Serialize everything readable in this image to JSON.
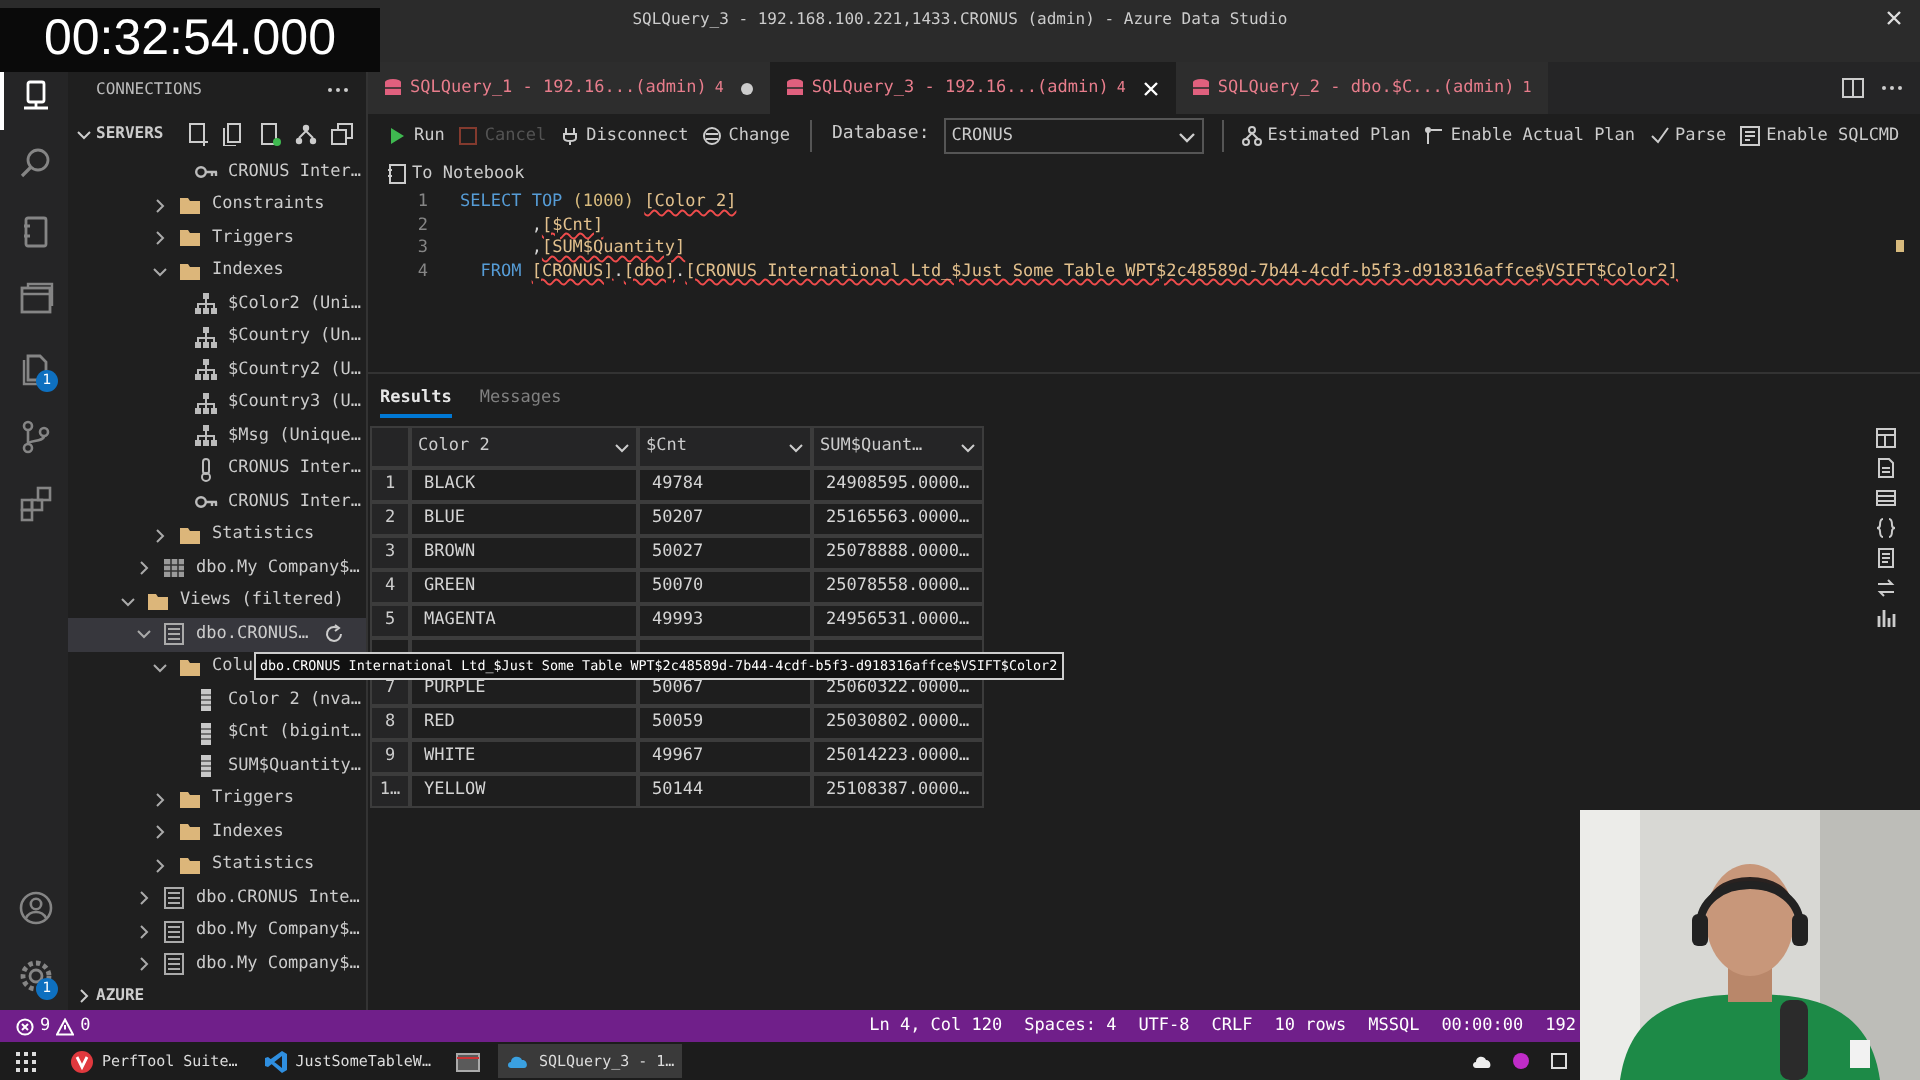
{
  "window": {
    "title": "SQLQuery_3 - 192.168.100.221,1433.CRONUS (admin) - Azure Data Studio"
  },
  "timer": "00:32:54.000",
  "activity_bar": {
    "items": [
      {
        "selected": true
      },
      {
        "selected": false
      },
      {
        "selected": false
      },
      {
        "selected": false
      },
      {
        "selected": false,
        "badge": "1"
      },
      {
        "selected": false
      },
      {
        "selected": false
      }
    ],
    "bottom_items": [
      {
        "selected": false
      },
      {
        "selected": false,
        "badge": "1"
      }
    ]
  },
  "sidebar": {
    "title": "CONNECTIONS",
    "section": "SERVERS",
    "footer_section": "AZURE",
    "tree": [
      {
        "kind": "offscreen",
        "children": [
          {
            "kind": "offscreen",
            "children": [
              {
                "kind": "offscreen",
                "children": [
                  {
                    "kind": "key",
                    "label": "CRONUS Inter…",
                    "selected": false
                  }
                ]
              },
              {
                "kind": "folder",
                "label": "Constraints",
                "expanded": false,
                "selected": false
              },
              {
                "kind": "folder",
                "label": "Triggers",
                "expanded": false,
                "selected": false
              },
              {
                "kind": "folder",
                "label": "Indexes",
                "expanded": true,
                "selected": false,
                "children": [
                  {
                    "kind": "index",
                    "label": "$Color2 (Uni…",
                    "selected": false
                  },
                  {
                    "kind": "index",
                    "label": "$Country (Un…",
                    "selected": false
                  },
                  {
                    "kind": "index",
                    "label": "$Country2 (U…",
                    "selected": false
                  },
                  {
                    "kind": "index",
                    "label": "$Country3 (U…",
                    "selected": false
                  },
                  {
                    "kind": "index",
                    "label": "$Msg (Unique…",
                    "selected": false
                  },
                  {
                    "kind": "check",
                    "label": "CRONUS Inter…",
                    "selected": false
                  },
                  {
                    "kind": "key",
                    "label": "CRONUS Inter…",
                    "selected": false
                  }
                ]
              },
              {
                "kind": "folder",
                "label": "Statistics",
                "expanded": false,
                "selected": false
              }
            ]
          },
          {
            "kind": "table",
            "label": "dbo.My Company$…",
            "expanded": false,
            "selected": false
          }
        ]
      },
      {
        "kind": "folder",
        "label": "Views (filtered)",
        "expanded": true,
        "selected": false,
        "children": [
          {
            "kind": "view",
            "label": "dbo.CRONUS…",
            "expanded": true,
            "selected": true,
            "children": [
              {
                "kind": "folder",
                "label": "Colu",
                "expanded": true,
                "selected": false,
                "children": [
                  {
                    "kind": "column",
                    "label": "Color 2 (nva…",
                    "selected": false
                  },
                  {
                    "kind": "column",
                    "label": "$Cnt (bigint…",
                    "selected": false
                  },
                  {
                    "kind": "column",
                    "label": "SUM$Quantity…",
                    "selected": false
                  }
                ]
              },
              {
                "kind": "folder",
                "label": "Triggers",
                "expanded": false,
                "selected": false
              },
              {
                "kind": "folder",
                "label": "Indexes",
                "expanded": false,
                "selected": false
              },
              {
                "kind": "folder",
                "label": "Statistics",
                "expanded": false,
                "selected": false
              }
            ]
          },
          {
            "kind": "view",
            "label": "dbo.CRONUS Inte…",
            "expanded": false,
            "selected": false
          },
          {
            "kind": "view",
            "label": "dbo.My Company$…",
            "expanded": false,
            "selected": false
          },
          {
            "kind": "view",
            "label": "dbo.My Company$…",
            "expanded": false,
            "selected": false
          }
        ]
      }
    ]
  },
  "editor": {
    "tabs": [
      {
        "label": "SQLQuery_1 - 192.16...(admin)",
        "count": "4",
        "selected": false,
        "dirty": true
      },
      {
        "label": "SQLQuery_3 - 192.16...(admin)",
        "count": "4",
        "selected": true,
        "dirty": false
      },
      {
        "label": "SQLQuery_2 - dbo.$C...(admin)",
        "count": "1",
        "selected": false,
        "dirty": false
      }
    ],
    "toolbar": {
      "buttons": [
        {
          "label": "Run",
          "disabled": false
        },
        {
          "label": "Cancel",
          "disabled": true
        },
        {
          "label": "Disconnect",
          "disabled": false
        },
        {
          "label": "Change",
          "disabled": false
        }
      ],
      "database_label": "Database:",
      "database": "CRONUS",
      "actions": [
        "Estimated Plan",
        "Enable Actual Plan",
        "Parse",
        "Enable SQLCMD"
      ],
      "notebook": "To Notebook"
    },
    "code": [
      {
        "number": "1",
        "tokens": [
          {
            "kind": "keyword",
            "text": "SELECT TOP "
          },
          {
            "kind": "number",
            "text": "(1000) "
          },
          {
            "kind": "identifier",
            "text": "[Color 2]",
            "error": true
          }
        ]
      },
      {
        "number": "2",
        "tokens": [
          {
            "kind": "punct",
            "text": "       ,"
          },
          {
            "kind": "identifier",
            "text": "[$Cnt]",
            "error": true
          }
        ]
      },
      {
        "number": "3",
        "tokens": [
          {
            "kind": "punct",
            "text": "       ,"
          },
          {
            "kind": "identifier",
            "text": "[SUM$Quantity]",
            "error": true
          }
        ]
      },
      {
        "number": "4",
        "tokens": [
          {
            "kind": "keyword",
            "text": "  FROM "
          },
          {
            "kind": "identifier",
            "text": "[CRONUS]",
            "error": true
          },
          {
            "kind": "punct",
            "text": "."
          },
          {
            "kind": "identifier",
            "text": "[dbo]",
            "error": true
          },
          {
            "kind": "punct",
            "text": "."
          },
          {
            "kind": "identifier",
            "text": "[CRONUS International Ltd_$Just Some Table WPT$2c48589d-7b44-4cdf-b5f3-d918316affce$VSIFT$Color2]",
            "error": true
          }
        ]
      }
    ]
  },
  "results": {
    "tabs": [
      {
        "label": "Results",
        "selected": true
      },
      {
        "label": "Messages",
        "selected": false
      }
    ],
    "columns": [
      "Color 2",
      "$Cnt",
      "SUM$Quant…"
    ],
    "rows": [
      {
        "number": "1",
        "cells": [
          "BLACK",
          "49784",
          "24908595.0000…"
        ]
      },
      {
        "number": "2",
        "cells": [
          "BLUE",
          "50207",
          "25165563.0000…"
        ]
      },
      {
        "number": "3",
        "cells": [
          "BROWN",
          "50027",
          "25078888.0000…"
        ]
      },
      {
        "number": "4",
        "cells": [
          "GREEN",
          "50070",
          "25078558.0000…"
        ]
      },
      {
        "number": "5",
        "cells": [
          "MAGENTA",
          "49993",
          "24956531.0000…"
        ]
      },
      {
        "kind": "covered"
      },
      {
        "number": "7",
        "cells": [
          "PURPLE",
          "50067",
          "25060322.0000…"
        ]
      },
      {
        "number": "8",
        "cells": [
          "RED",
          "50059",
          "25030802.0000…"
        ]
      },
      {
        "number": "9",
        "cells": [
          "WHITE",
          "49967",
          "25014223.0000…"
        ]
      },
      {
        "number": "1…",
        "cells": [
          "YELLOW",
          "50144",
          "25108387.0000…"
        ]
      }
    ]
  },
  "tooltip": "dbo.CRONUS International Ltd_$Just Some Table WPT$2c48589d-7b44-4cdf-b5f3-d918316affce$VSIFT$Color2",
  "status_bar": {
    "errors": "9",
    "warnings": "0",
    "items": [
      "Ln 4, Col 120",
      "Spaces: 4",
      "UTF-8",
      "CRLF",
      "10 rows",
      "MSSQL",
      "00:00:00",
      "192"
    ]
  },
  "taskbar": {
    "apps": [
      {
        "label": "PerfTool Suite…",
        "selected": false
      },
      {
        "label": "JustSomeTableW…",
        "selected": false
      },
      {
        "selected": false
      },
      {
        "label": "SQLQuery_3 - 1…",
        "selected": true
      }
    ]
  }
}
